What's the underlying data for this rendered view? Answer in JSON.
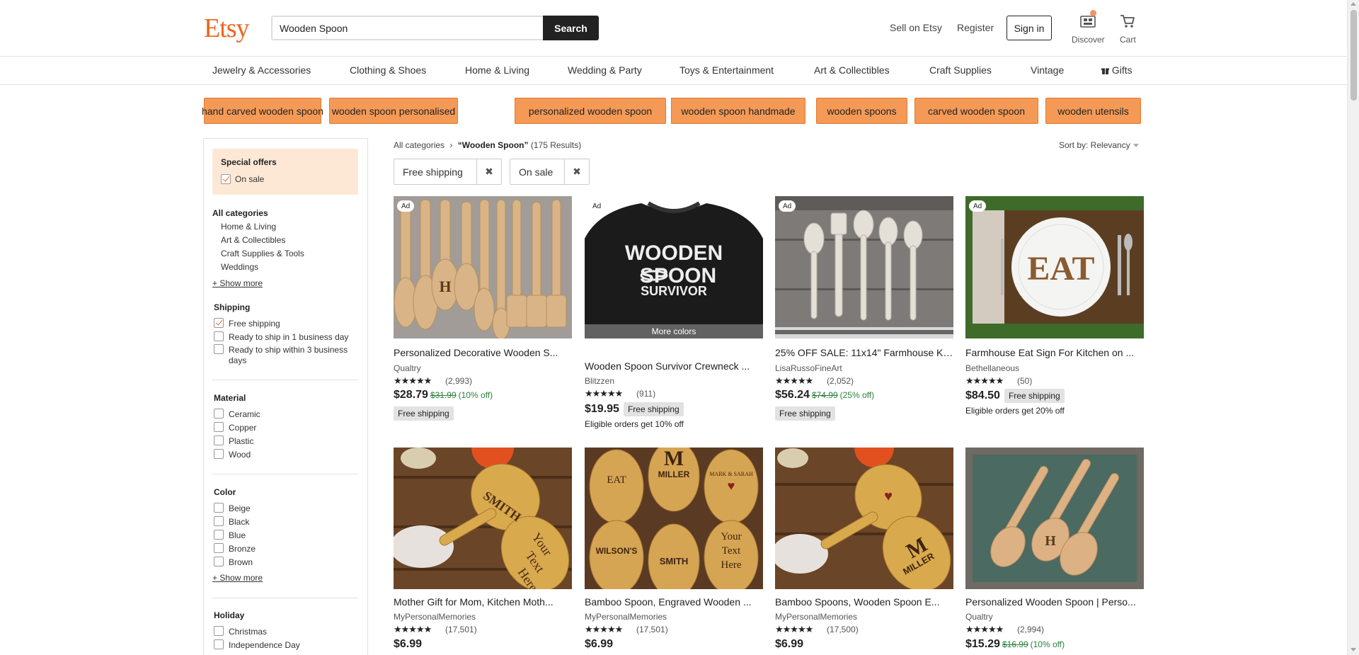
{
  "header": {
    "logo": "Etsy",
    "search_value": "Wooden Spoon",
    "search_button": "Search",
    "sell": "Sell on Etsy",
    "register": "Register",
    "sign_in": "Sign in",
    "discover": "Discover",
    "cart": "Cart"
  },
  "categories": [
    "Jewelry & Accessories",
    "Clothing & Shoes",
    "Home & Living",
    "Wedding & Party",
    "Toys & Entertainment",
    "Art & Collectibles",
    "Craft Supplies",
    "Vintage",
    "Gifts"
  ],
  "tags": [
    "hand carved wooden spoon",
    "wooden spoon personalised",
    "personalized wooden spoon",
    "wooden spoon handmade",
    "wooden spoons",
    "carved wooden spoon",
    "wooden utensils"
  ],
  "sidebar": {
    "special_offers": "Special offers",
    "on_sale": "On sale",
    "all_categories": "All categories",
    "category_links": [
      "Home & Living",
      "Art & Collectibles",
      "Craft Supplies & Tools",
      "Weddings"
    ],
    "show_more": "+ Show more",
    "shipping_title": "Shipping",
    "shipping_options": [
      "Free shipping",
      "Ready to ship in 1 business day",
      "Ready to ship within 3 business",
      "days"
    ],
    "material_title": "Material",
    "materials": [
      "Ceramic",
      "Copper",
      "Plastic",
      "Wood"
    ],
    "color_title": "Color",
    "colors": [
      "Beige",
      "Black",
      "Blue",
      "Bronze",
      "Brown"
    ],
    "holiday_title": "Holiday",
    "holidays": [
      "Christmas",
      "Independence Day"
    ]
  },
  "results": {
    "breadcrumb_root": "All categories",
    "query": "“Wooden Spoon”",
    "count": "(175 Results)",
    "sort": "Sort by: Relevancy",
    "chips": [
      "Free shipping",
      "On sale"
    ],
    "chip_close": "✖"
  },
  "listings": [
    {
      "ad": "Ad",
      "title": "Personalized Decorative Wooden S...",
      "shop": "Qualtry",
      "stars": "★★★★★",
      "reviews": "(2,993)",
      "price": "$28.79",
      "old": "$31.99",
      "off": "(10% off)",
      "badge": "Free shipping"
    },
    {
      "ad": "Ad",
      "more_colors": "More colors",
      "title": "Wooden Spoon Survivor Crewneck ...",
      "shop": "Blitzzen",
      "stars": "★★★★★",
      "reviews": "(911)",
      "price": "$19.95",
      "badge": "Free shipping",
      "eligible": "Eligible orders get 10% off"
    },
    {
      "ad": "Ad",
      "title": "25% OFF SALE: 11x14\" Farmhouse Ki...",
      "shop": "LisaRussoFineArt",
      "stars": "★★★★★",
      "reviews": "(2,052)",
      "price": "$56.24",
      "old": "$74.99",
      "off": "(25% off)",
      "badge": "Free shipping"
    },
    {
      "ad": "Ad",
      "title": "Farmhouse Eat Sign For Kitchen on ...",
      "shop": "Bethellaneous",
      "stars": "★★★★★",
      "reviews": "(50)",
      "price": "$84.50",
      "badge": "Free shipping",
      "eligible": "Eligible orders get 20% off"
    },
    {
      "title": "Mother Gift for Mom, Kitchen Moth...",
      "shop": "MyPersonalMemories",
      "stars": "★★★★★",
      "reviews": "(17,501)",
      "price": "$6.99"
    },
    {
      "title": "Bamboo Spoon, Engraved Wooden ...",
      "shop": "MyPersonalMemories",
      "stars": "★★★★★",
      "reviews": "(17,501)",
      "price": "$6.99"
    },
    {
      "title": "Bamboo Spoons, Wooden Spoon E...",
      "shop": "MyPersonalMemories",
      "stars": "★★★★★",
      "reviews": "(17,500)",
      "price": "$6.99"
    },
    {
      "title": "Personalized Wooden Spoon | Perso...",
      "shop": "Qualtry",
      "stars": "★★★★★",
      "reviews": "(2,994)",
      "price": "$15.29",
      "old": "$16.99",
      "off": "(10% off)"
    }
  ],
  "image_text": {
    "sweatshirt_line1": "WOODEN",
    "sweatshirt_line2": "SPOON",
    "sweatshirt_line3": "SURVIVOR",
    "eat_sign": "EAT",
    "spoon_family": "SMITH",
    "spoon_family2": "WILSON'S",
    "spoon_miller": "MILLER",
    "spoon_your": "Your",
    "spoon_text": "Text",
    "spoon_here": "Here",
    "spoon_letter_m": "M",
    "spoon_eat": "EAT",
    "spoon_mark_sarah": "MARK & SARAH",
    "spoon_letter_h": "H"
  },
  "colors": {
    "brand": "#f1641e",
    "tag_bg": "#f49a56",
    "sale_green": "#2a7f3a"
  }
}
